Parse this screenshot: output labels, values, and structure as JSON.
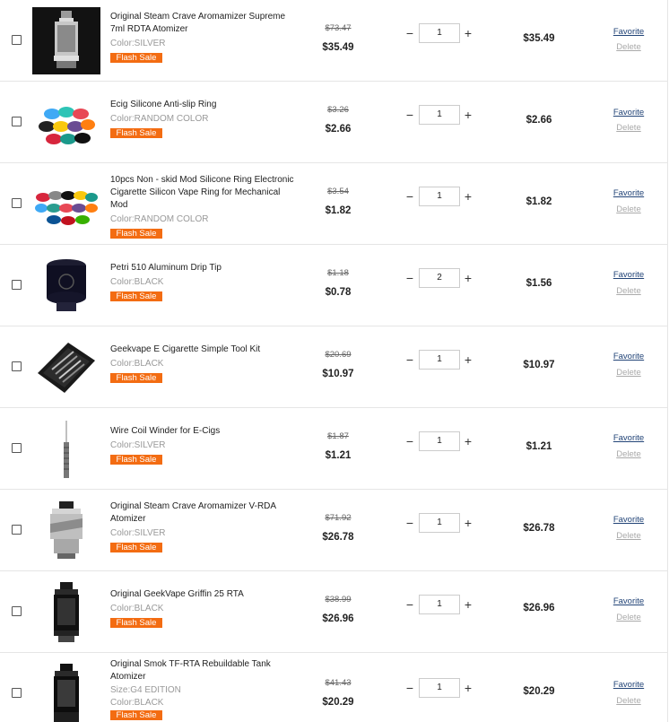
{
  "labels": {
    "flash_sale": "Flash Sale",
    "favorite": "Favorite",
    "delete": "Delete"
  },
  "items": [
    {
      "name": "Original Steam Crave Aromamizer Supreme 7ml RDTA Atomizer",
      "variants": [
        "Color:SILVER"
      ],
      "original_price": "$73.47",
      "sale_price": "$35.49",
      "qty": "1",
      "subtotal": "$35.49",
      "image": "rdta-atomizer-image"
    },
    {
      "name": "Ecig Silicone Anti-slip Ring",
      "variants": [
        "Color:RANDOM COLOR"
      ],
      "original_price": "$3.26",
      "sale_price": "$2.66",
      "qty": "1",
      "subtotal": "$2.66",
      "image": "silicone-rings-image"
    },
    {
      "name": "10pcs Non - skid Mod Silicone Ring Electronic Cigarette Silicon Vape Ring for Mechanical Mod",
      "variants": [
        "Color:RANDOM COLOR"
      ],
      "original_price": "$3.54",
      "sale_price": "$1.82",
      "qty": "1",
      "subtotal": "$1.82",
      "image": "vape-rings-image"
    },
    {
      "name": "Petri 510 Aluminum Drip Tip",
      "variants": [
        "Color:BLACK"
      ],
      "original_price": "$1.18",
      "sale_price": "$0.78",
      "qty": "2",
      "subtotal": "$1.56",
      "image": "drip-tip-image"
    },
    {
      "name": "Geekvape E Cigarette Simple Tool Kit",
      "variants": [
        "Color:BLACK"
      ],
      "original_price": "$20.69",
      "sale_price": "$10.97",
      "qty": "1",
      "subtotal": "$10.97",
      "image": "tool-kit-image"
    },
    {
      "name": "Wire Coil Winder for E-Cigs",
      "variants": [
        "Color:SILVER"
      ],
      "original_price": "$1.87",
      "sale_price": "$1.21",
      "qty": "1",
      "subtotal": "$1.21",
      "image": "coil-winder-image"
    },
    {
      "name": "Original Steam Crave Aromamizer V-RDA Atomizer",
      "variants": [
        "Color:SILVER"
      ],
      "original_price": "$71.92",
      "sale_price": "$26.78",
      "qty": "1",
      "subtotal": "$26.78",
      "image": "vrda-atomizer-image"
    },
    {
      "name": "Original GeekVape Griffin 25 RTA",
      "variants": [
        "Color:BLACK"
      ],
      "original_price": "$38.99",
      "sale_price": "$26.96",
      "qty": "1",
      "subtotal": "$26.96",
      "image": "griffin-rta-image"
    },
    {
      "name": "Original Smok TF-RTA Rebuildable Tank Atomizer",
      "variants": [
        "Size:G4 EDITION",
        "Color:BLACK"
      ],
      "original_price": "$41.43",
      "sale_price": "$20.29",
      "qty": "1",
      "subtotal": "$20.29",
      "image": "tf-rta-tank-image"
    }
  ]
}
